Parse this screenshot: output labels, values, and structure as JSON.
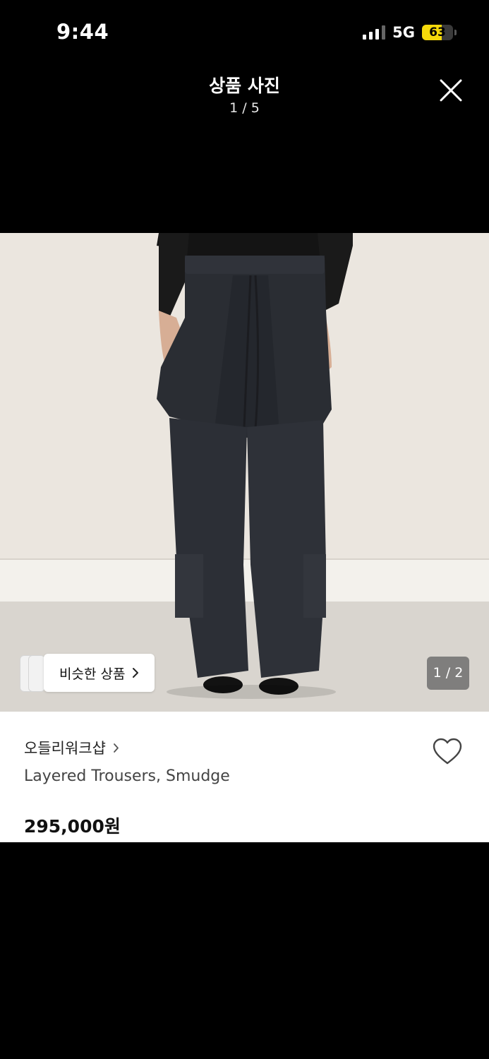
{
  "status_bar": {
    "time": "9:44",
    "network": "5G",
    "battery": "63",
    "battery_level": 0.63
  },
  "header": {
    "title": "상품 사진",
    "counter": "1 / 5",
    "close_icon": "close-icon"
  },
  "image": {
    "similar_button_label": "비슷한 상품",
    "counter": "1 / 2"
  },
  "product": {
    "shop_name": "오들리워크샵",
    "name": "Layered Trousers, Smudge",
    "price": "295,000원"
  },
  "colors": {
    "background": "#000000",
    "battery_fill": "#f5d90a",
    "panel": "#ffffff"
  }
}
